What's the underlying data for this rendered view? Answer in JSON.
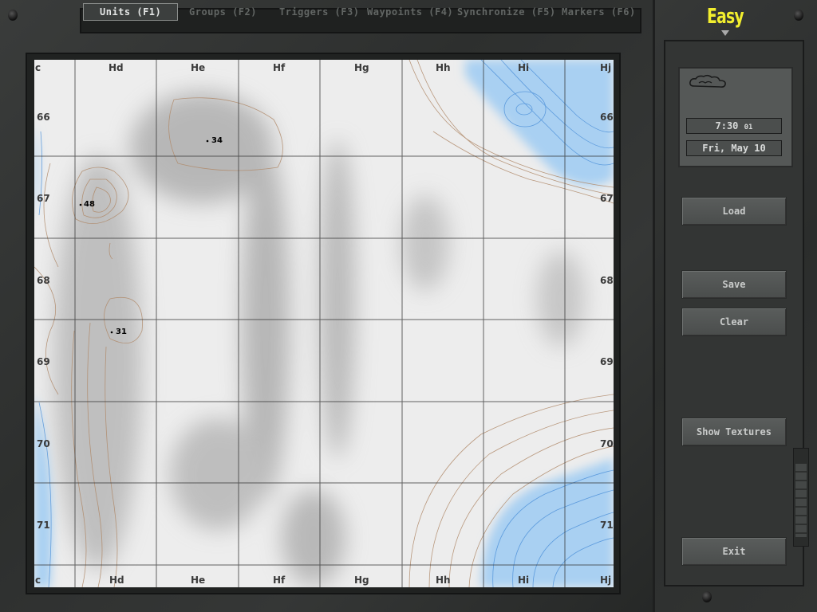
{
  "tabs": [
    {
      "label": "Units (F1)",
      "active": true
    },
    {
      "label": "Groups (F2)",
      "active": false
    },
    {
      "label": "Triggers (F3)",
      "active": false
    },
    {
      "label": "Waypoints (F4)",
      "active": false
    },
    {
      "label": "Synchronize (F5)",
      "active": false
    },
    {
      "label": "Markers (F6)",
      "active": false
    }
  ],
  "difficulty": "Easy",
  "weather_icon": "cloud-icon",
  "time": {
    "main": "7:30",
    "seconds": "01"
  },
  "date": "Fri, May 10",
  "buttons": {
    "load": "Load",
    "save": "Save",
    "clear": "Clear",
    "show_textures": "Show Textures",
    "exit": "Exit"
  },
  "map": {
    "columns": [
      "c",
      "Hd",
      "He",
      "Hf",
      "Hg",
      "Hh",
      "Hi",
      "Hj"
    ],
    "rows": [
      "66",
      "67",
      "68",
      "69",
      "70",
      "71"
    ],
    "elevations": [
      "34",
      "48",
      "31"
    ]
  },
  "colors": {
    "difficulty": "#f2ee2e",
    "water": "#a9d0f2",
    "contour_land": "#b08a6a",
    "contour_water": "#4a8ed8"
  }
}
